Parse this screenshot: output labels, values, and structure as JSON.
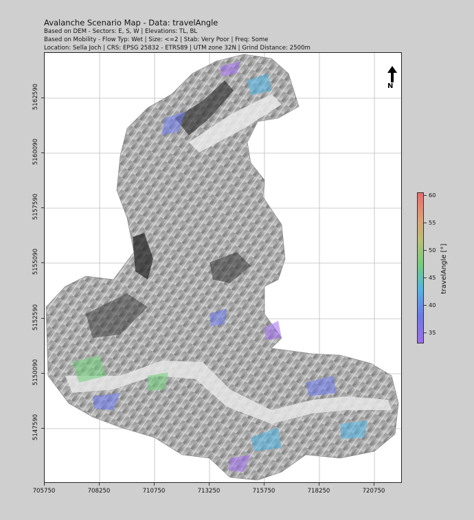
{
  "header": {
    "title": "Avalanche Scenario Map - Data: travelAngle",
    "line1": "Based on DEM - Sectors: E, S, W |  Elevations: TL, BL",
    "line2": "Based on Mobility - Flow Typ: Wet |  Size: <=2 |  Stab: Very Poor |  Freq: Some",
    "line3": "Location: Sella Joch | CRS: EPSG 25832 - ETRS89 | UTM zone 32N | Grind Distance: 2500m"
  },
  "north_arrow": {
    "label": "N"
  },
  "x_axis": {
    "ticks": [
      "705750",
      "708250",
      "710750",
      "713250",
      "715750",
      "718250",
      "720750"
    ]
  },
  "y_axis": {
    "ticks": [
      "5162590",
      "5160090",
      "5157590",
      "5155090",
      "5152590",
      "5150090",
      "5147590"
    ]
  },
  "colorbar": {
    "label": "travelAngle [°]",
    "ticks": [
      "60",
      "55",
      "50",
      "45",
      "40",
      "35"
    ],
    "colors": [
      "#a06cf0",
      "#6a78f0",
      "#4fb6e6",
      "#6fd07a",
      "#b8c070",
      "#e0a070",
      "#ef6a6a"
    ]
  }
}
